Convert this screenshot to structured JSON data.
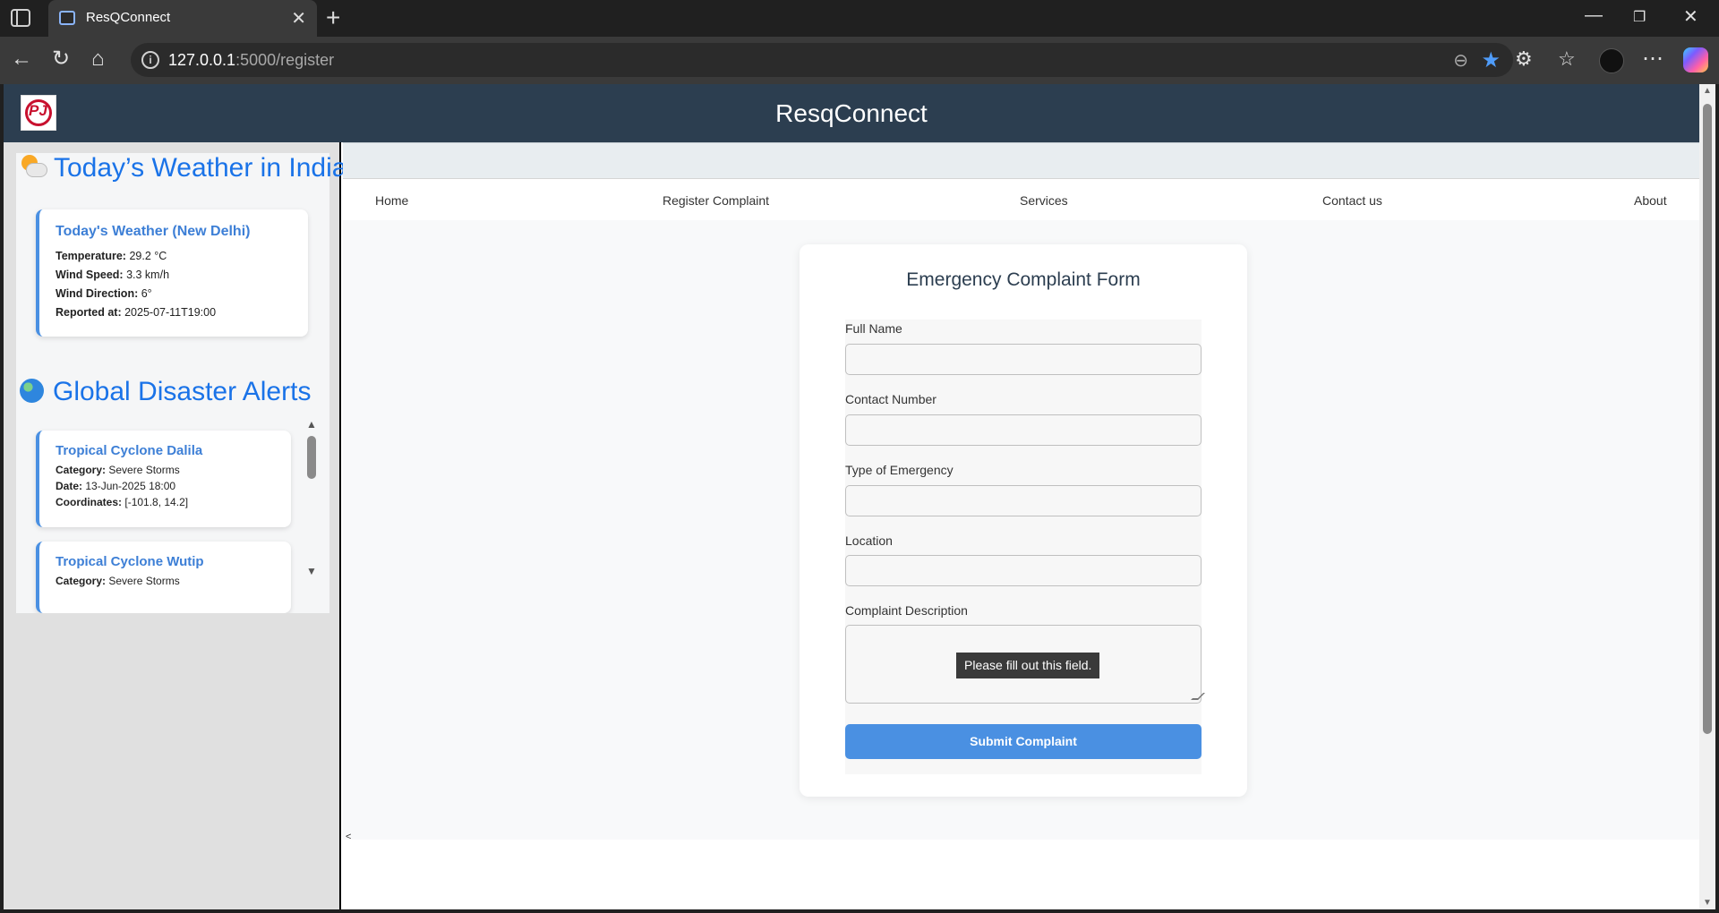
{
  "browser": {
    "tab_title": "ResQConnect",
    "url_host": "127.0.0.1",
    "url_path": ":5000/register"
  },
  "site": {
    "title": "ResqConnect",
    "logo_text": "PJ"
  },
  "weather": {
    "heading": "Today’s Weather in India",
    "card_title": "Today's Weather (New Delhi)",
    "rows": [
      {
        "label": "Temperature:",
        "value": "29.2 °C"
      },
      {
        "label": "Wind Speed:",
        "value": "3.3 km/h"
      },
      {
        "label": "Wind Direction:",
        "value": "6°"
      },
      {
        "label": "Reported at:",
        "value": "2025-07-11T19:00"
      }
    ]
  },
  "alerts": {
    "heading": "Global Disaster Alerts",
    "items": [
      {
        "title": "Tropical Cyclone Dalila",
        "category_label": "Category:",
        "category": "Severe Storms",
        "date_label": "Date:",
        "date": "13-Jun-2025 18:00",
        "coords_label": "Coordinates:",
        "coords": "[-101.8, 14.2]"
      },
      {
        "title": "Tropical Cyclone Wutip",
        "category_label": "Category:",
        "category": "Severe Storms"
      }
    ]
  },
  "nav": {
    "home": "Home",
    "register": "Register Complaint",
    "services": "Services",
    "contact": "Contact us",
    "about": "About"
  },
  "form": {
    "title": "Emergency Complaint Form",
    "full_name_label": "Full Name",
    "contact_label": "Contact Number",
    "emergency_type_label": "Type of Emergency",
    "location_label": "Location",
    "description_label": "Complaint Description",
    "validation_tooltip": "Please fill out this field.",
    "submit_label": "Submit Complaint"
  },
  "sidebar_toggle": "<",
  "colors": {
    "header_bg": "#2c3e50",
    "accent": "#4a90e2",
    "heading_blue": "#1a73e8"
  }
}
